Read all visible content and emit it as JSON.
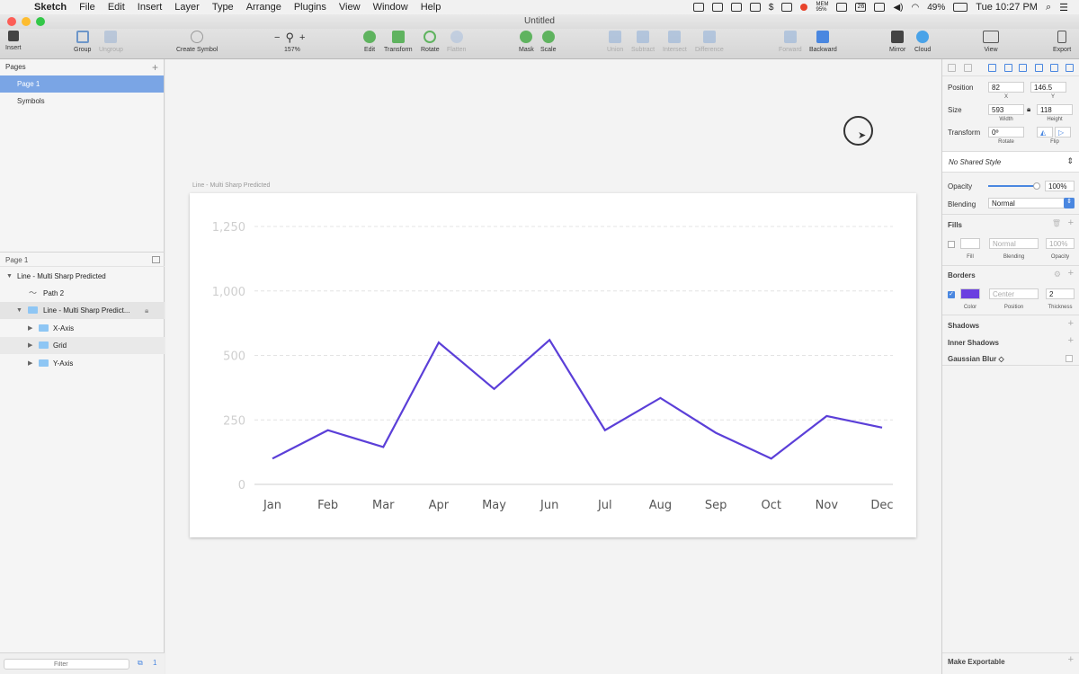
{
  "menubar": {
    "app": "Sketch",
    "items": [
      "File",
      "Edit",
      "Insert",
      "Layer",
      "Type",
      "Arrange",
      "Plugins",
      "View",
      "Window",
      "Help"
    ],
    "mem_label": "MEM",
    "mem_value": "95%",
    "calendar_day": "26",
    "battery": "49%",
    "clock": "Tue 10:27 PM"
  },
  "window": {
    "title": "Untitled"
  },
  "toolbar": {
    "insert": "Insert",
    "group": "Group",
    "ungroup": "Ungroup",
    "create_symbol": "Create Symbol",
    "zoom": "157%",
    "zoom_minus": "−",
    "zoom_plus": "+",
    "edit": "Edit",
    "transform": "Transform",
    "rotate": "Rotate",
    "flatten": "Flatten",
    "mask": "Mask",
    "scale": "Scale",
    "union": "Union",
    "subtract": "Subtract",
    "intersect": "Intersect",
    "difference": "Difference",
    "forward": "Forward",
    "backward": "Backward",
    "mirror": "Mirror",
    "cloud": "Cloud",
    "view": "View",
    "export": "Export"
  },
  "pages": {
    "header": "Pages",
    "items": [
      {
        "label": "Page 1",
        "selected": true
      },
      {
        "label": "Symbols",
        "selected": false
      }
    ]
  },
  "layers": {
    "header": "Page 1",
    "items": [
      {
        "label": "Line - Multi Sharp Predicted"
      },
      {
        "label": "Path 2"
      },
      {
        "label": "Line - Multi Sharp Predict..."
      },
      {
        "label": "X-Axis"
      },
      {
        "label": "Grid"
      },
      {
        "label": "Y-Axis"
      }
    ],
    "filter_placeholder": "Filter",
    "bottom_count": "1"
  },
  "artboard": {
    "label": "Line - Multi Sharp Predicted"
  },
  "chart_data": {
    "type": "line",
    "categories": [
      "Jan",
      "Feb",
      "Mar",
      "Apr",
      "May",
      "Jun",
      "Jul",
      "Aug",
      "Sep",
      "Oct",
      "Nov",
      "Dec"
    ],
    "series": [
      {
        "values": [
          100,
          210,
          145,
          550,
          370,
          560,
          210,
          335,
          200,
          100,
          265,
          220
        ],
        "color": "#5b3fd8"
      }
    ],
    "y_ticks": [
      "0",
      "250",
      "500",
      "1,000",
      "1,250"
    ],
    "y_tick_levels": [
      0,
      250,
      500,
      750,
      1000
    ],
    "ylim": [
      0,
      1000
    ],
    "grid": true,
    "xlabel": "",
    "ylabel": "",
    "title": ""
  },
  "inspector": {
    "position_label": "Position",
    "x": "82",
    "y": "146.5",
    "x_sub": "X",
    "y_sub": "Y",
    "size_label": "Size",
    "width": "593",
    "height": "118",
    "width_sub": "Width",
    "height_sub": "Height",
    "transform_label": "Transform",
    "rotate": "0º",
    "rotate_sub": "Rotate",
    "flip_sub": "Flip",
    "shared_style": "No Shared Style",
    "opacity_label": "Opacity",
    "opacity_value": "100%",
    "opacity_level": 0.95,
    "blending_label": "Blending",
    "blending_value": "Normal",
    "fills_label": "Fills",
    "fill_blending": "Normal",
    "fill_opacity": "100%",
    "fill_sub": "Fill",
    "fill_blending_sub": "Blending",
    "fill_opacity_sub": "Opacity",
    "borders_label": "Borders",
    "border_color": "#6a3fe0",
    "border_position": "Center",
    "border_thickness": "2",
    "border_color_sub": "Color",
    "border_position_sub": "Position",
    "border_thickness_sub": "Thickness",
    "shadows_label": "Shadows",
    "inner_shadows_label": "Inner Shadows",
    "blur_label": "Gaussian Blur ◇",
    "make_exportable": "Make Exportable"
  }
}
